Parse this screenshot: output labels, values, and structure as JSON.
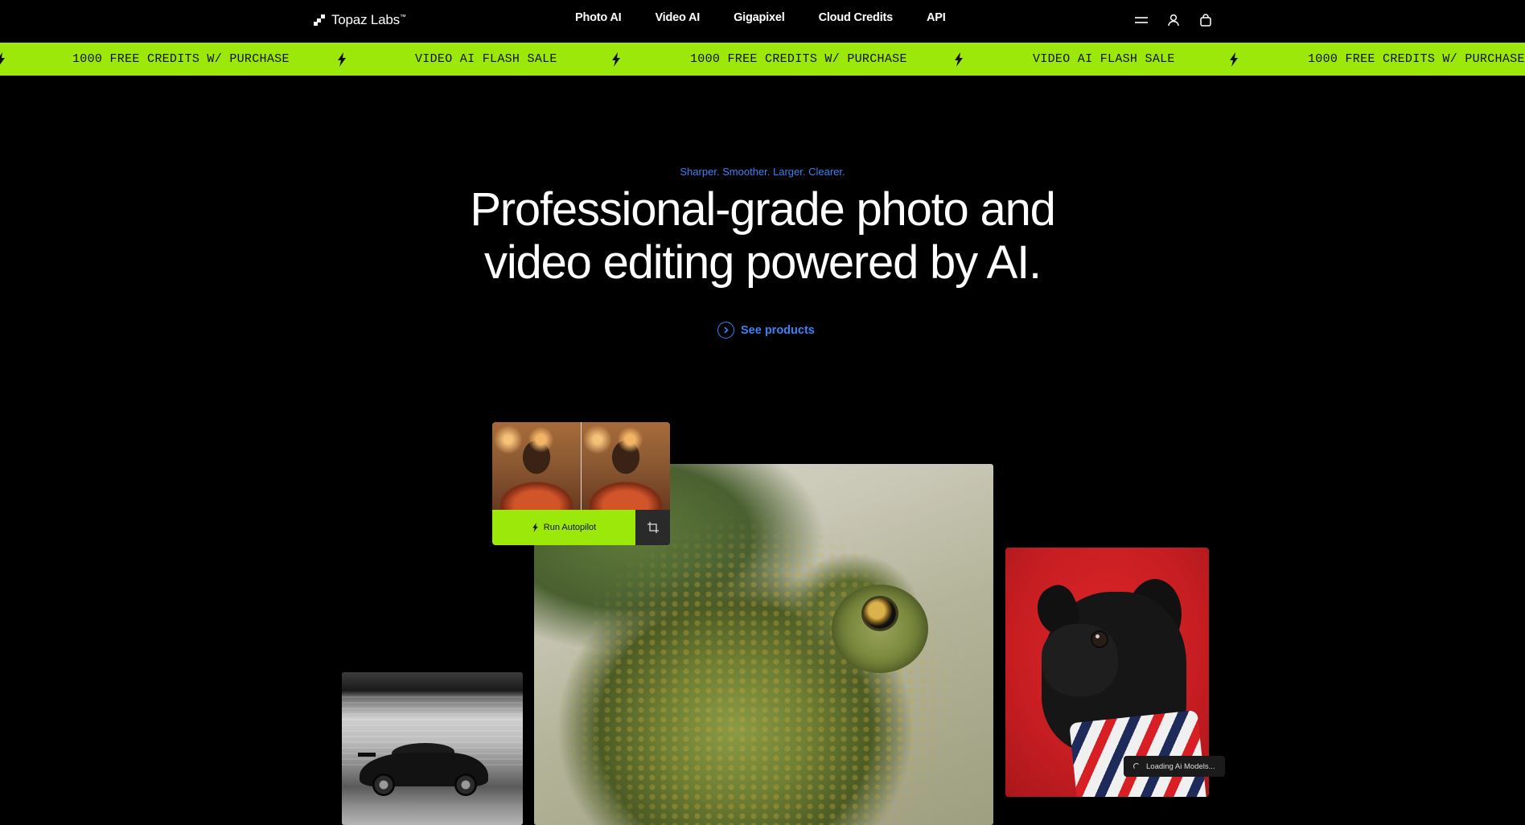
{
  "nav": {
    "logo_text": "Topaz Labs",
    "logo_tm": "™",
    "links": [
      "Photo AI",
      "Video AI",
      "Gigapixel",
      "Cloud Credits",
      "API"
    ],
    "icons": [
      "menu-icon",
      "user-icon",
      "cart-icon"
    ]
  },
  "ticker": {
    "background": "#9be80a",
    "items": [
      "1000 FREE CREDITS W/ PURCHASE",
      "VIDEO AI FLASH SALE",
      "1000 FREE CREDITS W/ PURCHASE",
      "VIDEO AI FLASH SALE",
      "1000 FREE CREDITS W/ PURCHASE"
    ],
    "separator_icon": "lightning-bolt-icon"
  },
  "hero": {
    "tagline": "Sharper. Smoother. Larger. Clearer.",
    "headline_line1": "Professional-grade photo and",
    "headline_line2": "video editing powered by AI.",
    "cta_label": "See products",
    "accent_color": "#3b82f6"
  },
  "showcase": {
    "autopilot_button": "Run Autopilot",
    "loading_label": "Loading Ai Models..."
  }
}
